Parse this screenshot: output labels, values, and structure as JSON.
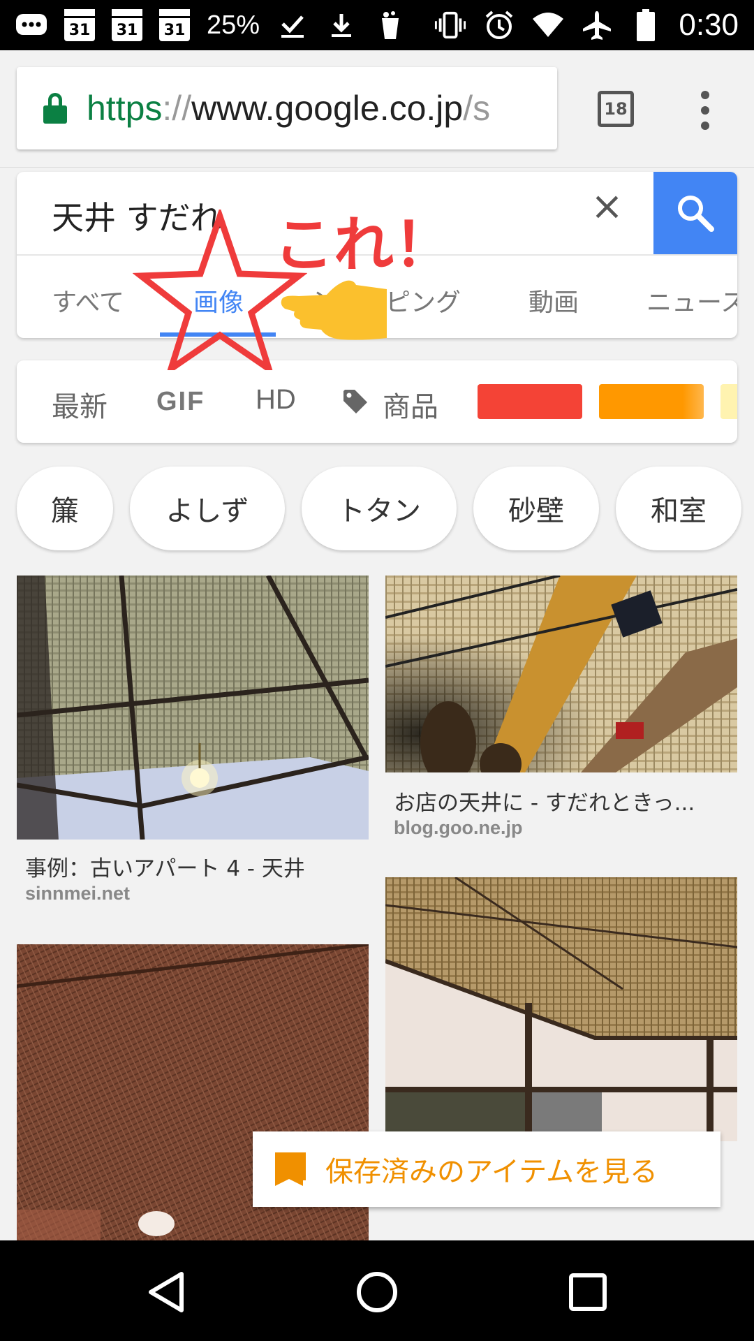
{
  "status_bar": {
    "calendar_dates": [
      "31",
      "31",
      "31"
    ],
    "battery_saver_text": "25%",
    "time": "0:30",
    "icons": [
      "chat-icon",
      "calendar-icon",
      "calendar-icon",
      "calendar-icon",
      "check-icon",
      "download-icon",
      "cup-icon",
      "vibrate-icon",
      "alarm-icon",
      "wifi-icon",
      "airplane-icon",
      "battery-icon"
    ]
  },
  "browser": {
    "url_scheme": "https",
    "url_sep": "://",
    "url_host": "www.google.co.jp",
    "url_rest": "/s",
    "tab_count": "18"
  },
  "search": {
    "query": "天井 すだれ",
    "clear_label": "×",
    "tabs": [
      "すべて",
      "画像",
      "ショッピング",
      "動画",
      "ニュース"
    ],
    "active_tab": "画像"
  },
  "filters": {
    "items": [
      "最新",
      "GIF",
      "HD",
      "商品"
    ],
    "color_swatches": [
      "#f44336",
      "#ff9800",
      "#ffeb3b"
    ]
  },
  "chips": [
    "簾",
    "よしず",
    "トタン",
    "砂壁",
    "和室"
  ],
  "results": [
    {
      "caption": "事例：古いアパート 4 - 天井",
      "source": "sinnmei.net"
    },
    {
      "caption": "お店の天井に - すだれときっ...",
      "source": "blog.goo.ne.jp"
    }
  ],
  "annotation": {
    "text": "これ！",
    "color": "#ef3b3b"
  },
  "saved_button": {
    "label": "保存済みのアイテムを見る",
    "color": "#f09000"
  },
  "accent_color": "#4285f4"
}
